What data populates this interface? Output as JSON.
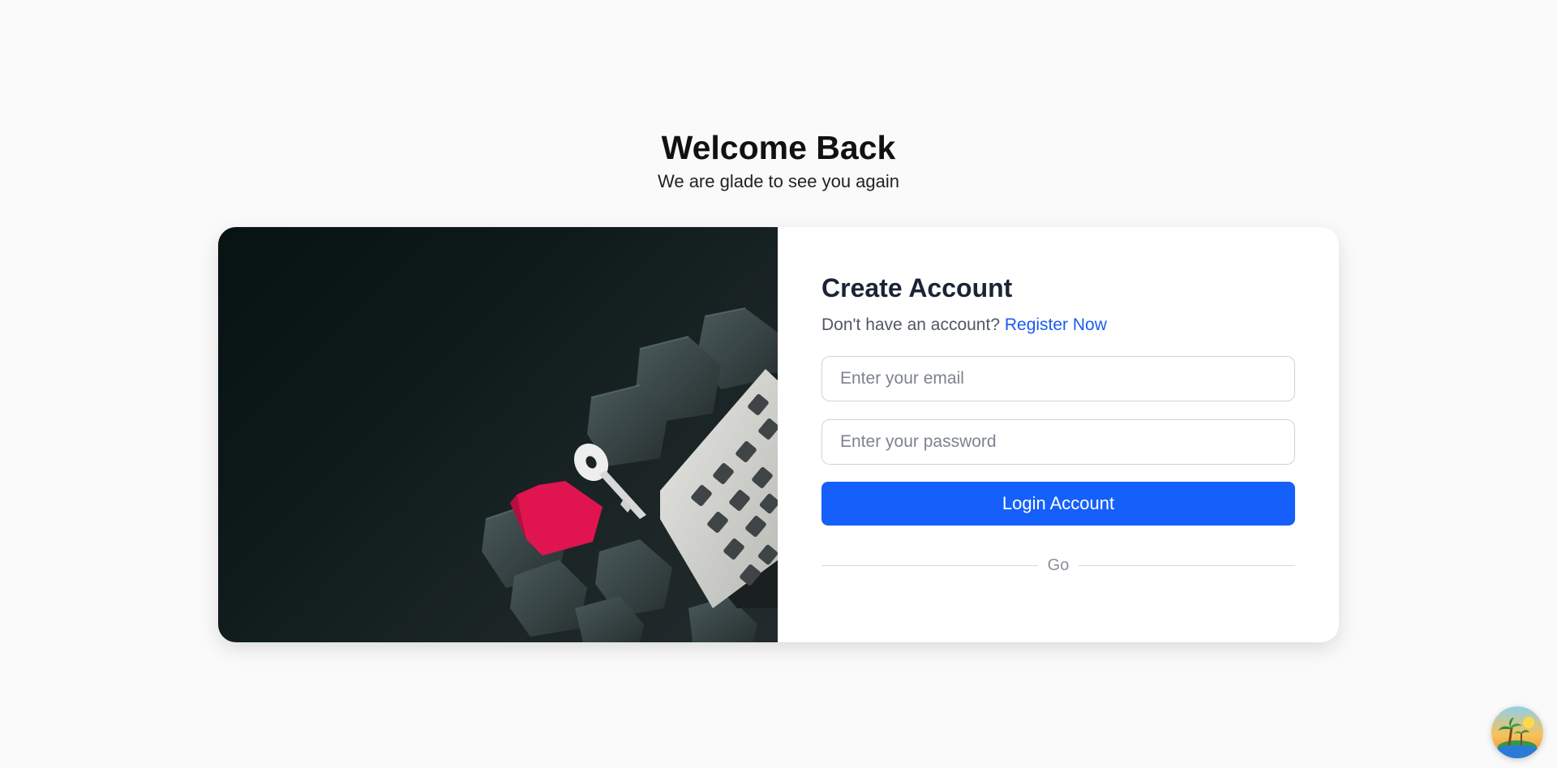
{
  "hero": {
    "title": "Welcome Back",
    "subtitle": "We are glade to see you again"
  },
  "form": {
    "title": "Create Account",
    "prompt": "Don't have an account?",
    "register_link": "Register Now",
    "email_placeholder": "Enter your email",
    "password_placeholder": "Enter your password",
    "login_label": "Login Account",
    "divider_label": "Go"
  },
  "image": {
    "icon": "house-key-calculator-photo"
  },
  "corner_widget": {
    "icon": "tropical-island-avatar-icon"
  },
  "colors": {
    "accent": "#1560fa",
    "link": "#1a5cf0",
    "background": "#fafafa"
  }
}
